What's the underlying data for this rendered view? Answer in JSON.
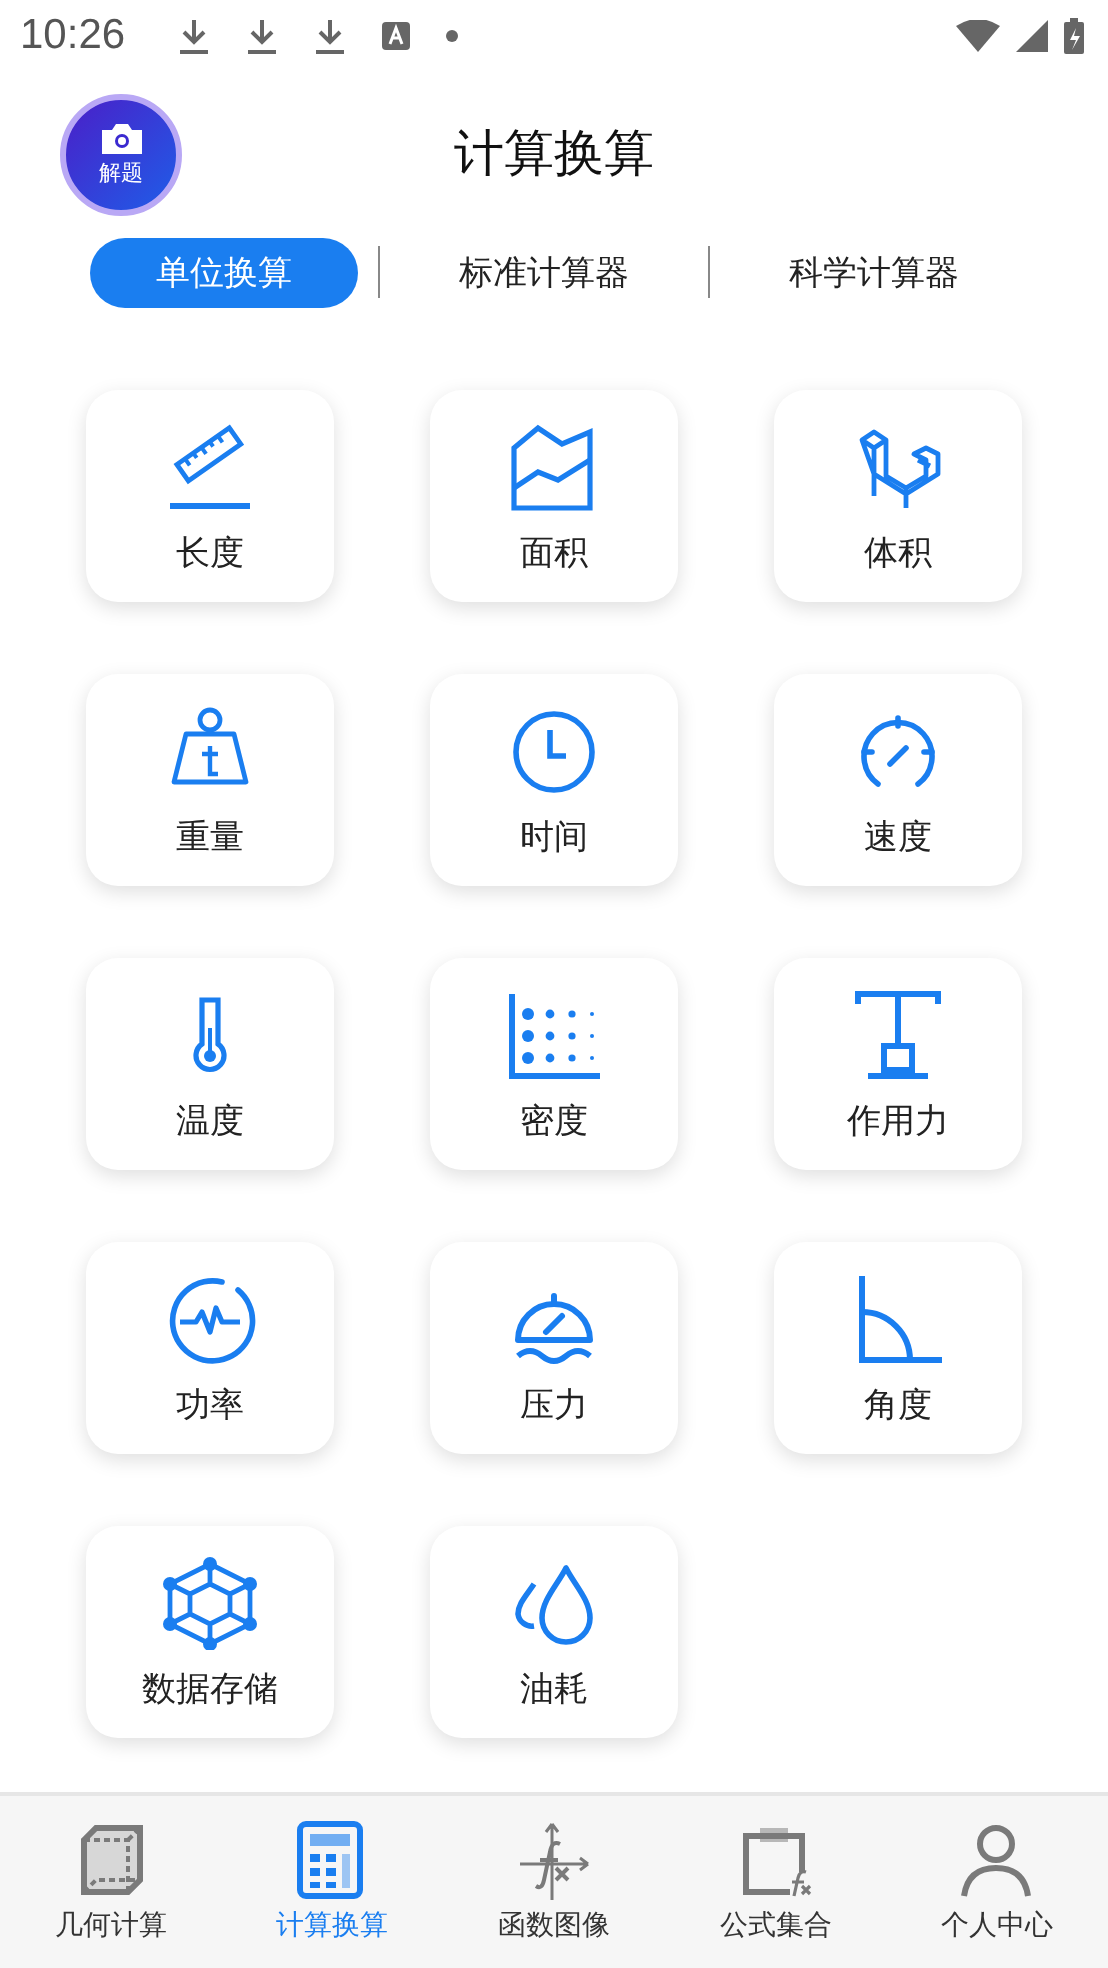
{
  "status_bar": {
    "time": "10:26"
  },
  "header": {
    "solve_button": {
      "label": "解题"
    },
    "title": "计算换算"
  },
  "tabs": [
    {
      "label": "单位换算",
      "selected": true
    },
    {
      "label": "标准计算器",
      "selected": false
    },
    {
      "label": "科学计算器",
      "selected": false
    }
  ],
  "tools": [
    {
      "label": "长度"
    },
    {
      "label": "面积"
    },
    {
      "label": "体积"
    },
    {
      "label": "重量"
    },
    {
      "label": "时间"
    },
    {
      "label": "速度"
    },
    {
      "label": "温度"
    },
    {
      "label": "密度"
    },
    {
      "label": "作用力"
    },
    {
      "label": "功率"
    },
    {
      "label": "压力"
    },
    {
      "label": "角度"
    },
    {
      "label": "数据存储"
    },
    {
      "label": "油耗"
    }
  ],
  "bottom_nav": [
    {
      "label": "几何计算",
      "selected": false
    },
    {
      "label": "计算换算",
      "selected": true
    },
    {
      "label": "函数图像",
      "selected": false
    },
    {
      "label": "公式集合",
      "selected": false
    },
    {
      "label": "个人中心",
      "selected": false
    }
  ]
}
